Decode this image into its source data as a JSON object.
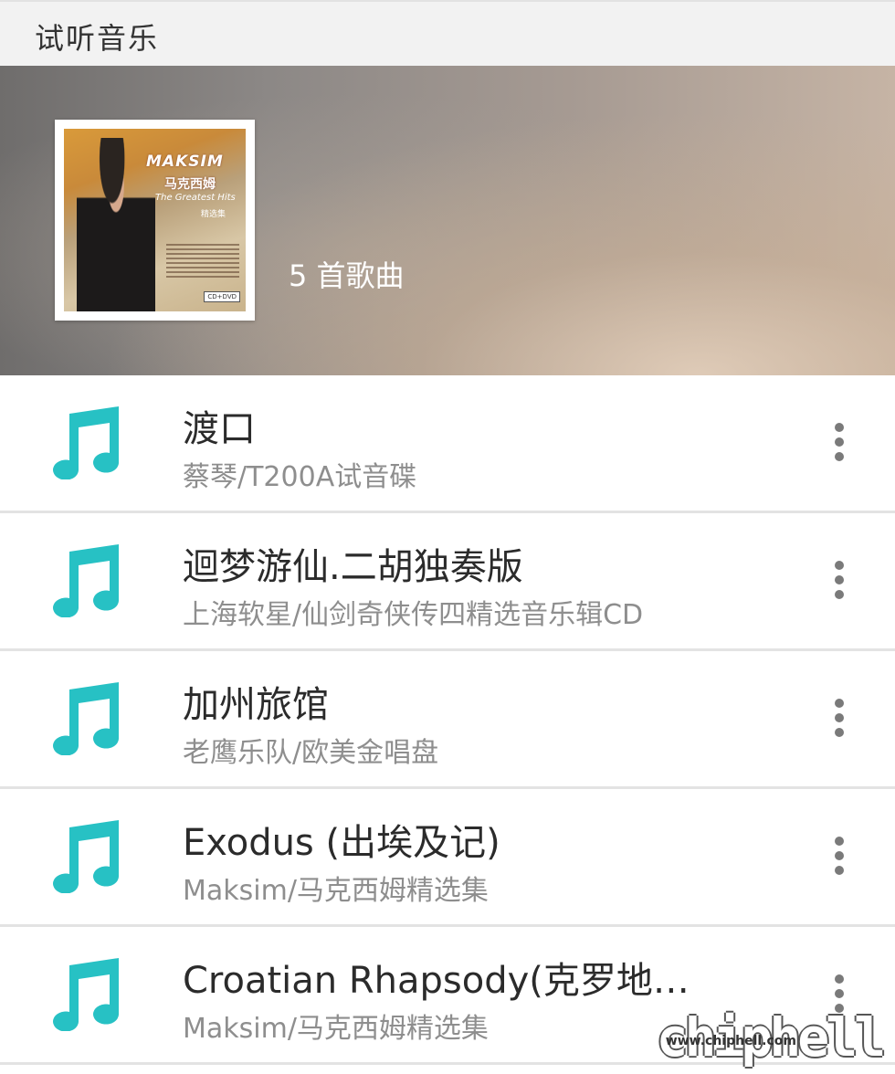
{
  "titlebar": {
    "title": "试听音乐"
  },
  "header": {
    "song_count": "5 首歌曲",
    "cover": {
      "brand": "MAKSIM",
      "brand_cn": "马克西姆",
      "subtitle": "The Greatest Hits",
      "subtitle_cn": "精选集",
      "format_tag": "CD+DVD"
    }
  },
  "songs": [
    {
      "title": "渡口",
      "meta": "蔡琴/T200A试音碟"
    },
    {
      "title": "迴梦游仙.二胡独奏版",
      "meta": "上海软星/仙剑奇侠传四精选音乐辑CD"
    },
    {
      "title": "加州旅馆",
      "meta": "老鹰乐队/欧美金唱盘"
    },
    {
      "title": "Exodus (出埃及记)",
      "meta": "Maksim/马克西姆精选集"
    },
    {
      "title": "Croatian Rhapsody(克罗地…",
      "meta": "Maksim/马克西姆精选集"
    }
  ],
  "icons": {
    "song_icon": "music-note-icon",
    "menu_icon": "more-vertical-icon"
  },
  "colors": {
    "accent": "#27c1c4",
    "title_text": "#2b2b2b",
    "meta_text": "#8e8e8e"
  },
  "watermark": {
    "logo": "chiphell",
    "url": "www.chiphell.com"
  }
}
